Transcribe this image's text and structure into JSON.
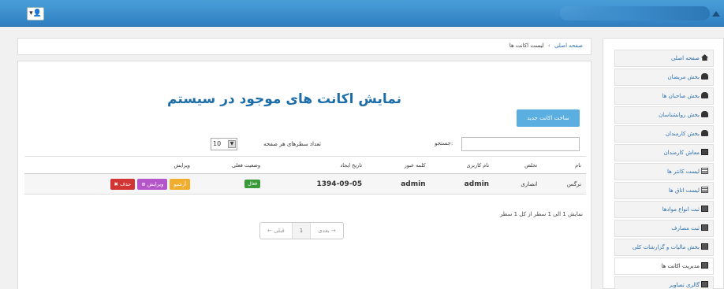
{
  "topbar": {
    "user_button_label": "▾👤"
  },
  "breadcrumb": {
    "home": "صفحه اصلی",
    "separator": "›",
    "current": "لیست اکانت ها"
  },
  "main": {
    "title": "نمایش اکانت های موجود در سیستم",
    "new_account_button": "ساخت اکانت جدید",
    "search_label": "جستجو:",
    "search_value": "",
    "page_length_label": "تعداد سطرهای هر صفحه",
    "page_length_value": "10",
    "table": {
      "headers": [
        "نام",
        "تخلص",
        "نام کاربری",
        "کلمه عبور",
        "تاریخ ایجاد",
        "وضعیت فعلی",
        "ویرایش"
      ],
      "rows": [
        {
          "first_name": "نرگس",
          "last_name": "انصاری",
          "username": "admin",
          "password": "admin",
          "created": "1394-09-05",
          "status": "فعال",
          "archive_label": "آرشیو",
          "edit_label": "ویرایش",
          "delete_label": "حذف"
        }
      ]
    },
    "info_text": "نمایش 1 الی 1 سطر از کل 1 سطر",
    "pager": {
      "prev": "← قبلی",
      "page": "1",
      "next": "بعدی →"
    }
  },
  "sidebar": {
    "items": [
      {
        "label": "صفحه اصلی",
        "icon": "home-icon"
      },
      {
        "label": "بخش مریضان",
        "icon": "user-icon"
      },
      {
        "label": "بخش صاحبان ها",
        "icon": "user-icon"
      },
      {
        "label": "بخش روانشناسان",
        "icon": "user-icon"
      },
      {
        "label": "بخش کارمندان",
        "icon": "user-icon"
      },
      {
        "label": "معاش کارمندان",
        "icon": "briefcase-icon"
      },
      {
        "label": "لیست کانتر ها",
        "icon": "table-icon"
      },
      {
        "label": "لیست اتاق ها",
        "icon": "table-icon"
      },
      {
        "label": "ثبت انواع موادها",
        "icon": "chart-icon"
      },
      {
        "label": "ثبت مصارف",
        "icon": "chart-icon"
      },
      {
        "label": "بخش مالیات و گزارشات کلی",
        "icon": "chart-icon"
      },
      {
        "label": "مدیریت اکانت ها",
        "icon": "chart-icon"
      },
      {
        "label": "گالری تصاویر",
        "icon": "chart-icon"
      }
    ],
    "active_index": 11
  },
  "colors": {
    "topbar": "#3a8fcf",
    "accent": "#1d6ea8",
    "button_primary": "#5aaee0",
    "archive": "#f0ad2e",
    "edit": "#b455c9",
    "delete": "#d23333",
    "status_active": "#3a9a3a"
  }
}
